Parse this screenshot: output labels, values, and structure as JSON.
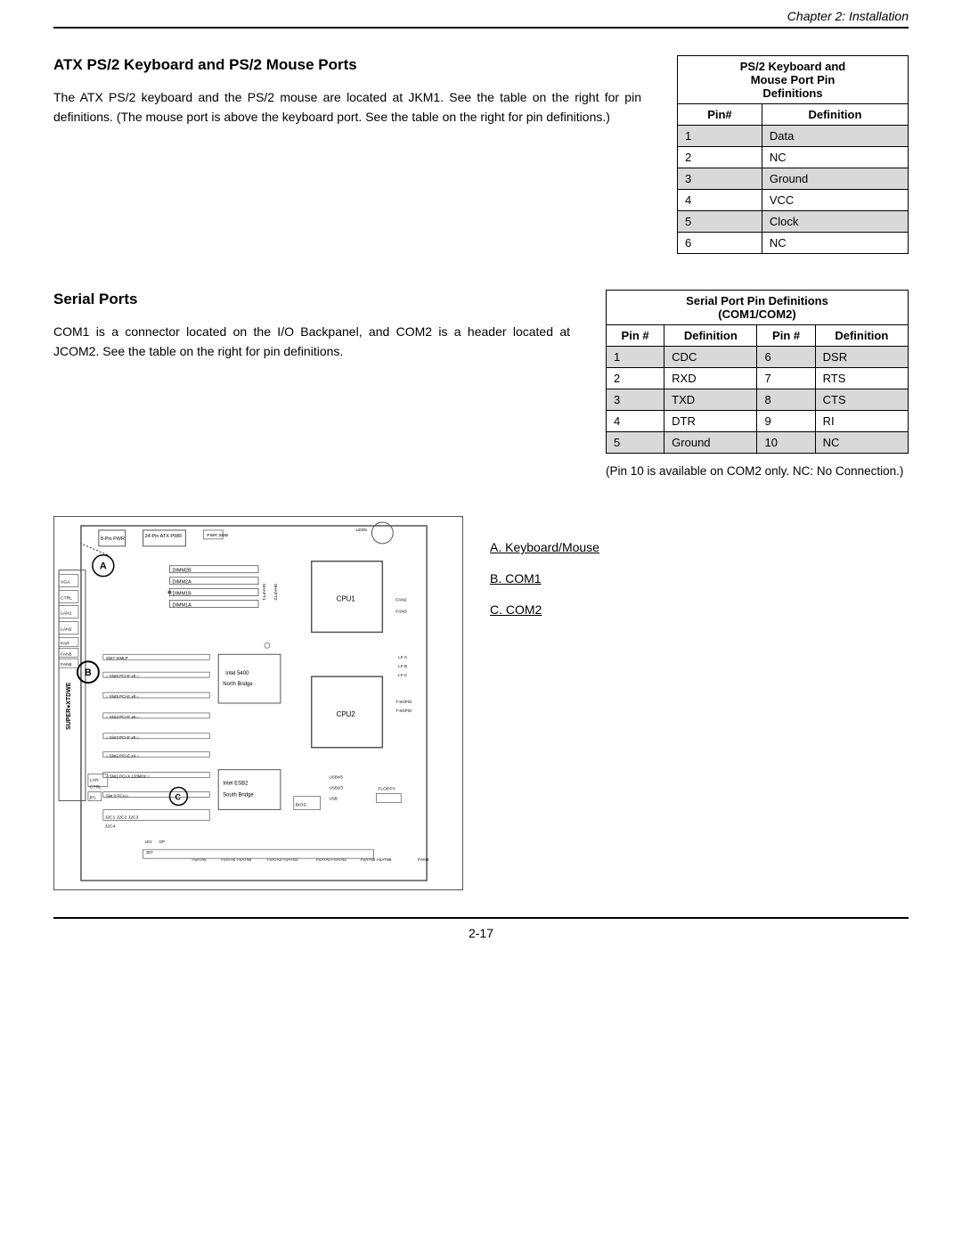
{
  "header": {
    "chapter": "Chapter 2: Installation"
  },
  "ps2_section": {
    "title": "ATX PS/2 Keyboard and PS/2 Mouse Ports",
    "body": "The ATX PS/2 keyboard and the PS/2 mouse are located at JKM1. See the table on the right for pin definitions. (The mouse port is above the keyboard port. See the table on the right for pin definitions.)",
    "table": {
      "title_line1": "PS/2 Keyboard and",
      "title_line2": "Mouse Port Pin",
      "title_line3": "Definitions",
      "col1": "Pin#",
      "col2": "Definition",
      "rows": [
        {
          "pin": "1",
          "def": "Data",
          "shaded": true
        },
        {
          "pin": "2",
          "def": "NC",
          "shaded": false
        },
        {
          "pin": "3",
          "def": "Ground",
          "shaded": true
        },
        {
          "pin": "4",
          "def": "VCC",
          "shaded": false
        },
        {
          "pin": "5",
          "def": "Clock",
          "shaded": true
        },
        {
          "pin": "6",
          "def": "NC",
          "shaded": false
        }
      ]
    }
  },
  "serial_section": {
    "title": "Serial Ports",
    "body": "COM1 is a connector located on the I/O Backpanel, and COM2 is a header located at JCOM2. See the table on the right for pin definitions.",
    "table": {
      "title_line1": "Serial Port Pin Definitions",
      "title_line2": "(COM1/COM2)",
      "col1": "Pin #",
      "col2": "Definition",
      "col3": "Pin #",
      "col4": "Definition",
      "rows": [
        {
          "pin1": "1",
          "def1": "CDC",
          "pin2": "6",
          "def2": "DSR",
          "shaded": true
        },
        {
          "pin1": "2",
          "def1": "RXD",
          "pin2": "7",
          "def2": "RTS",
          "shaded": false
        },
        {
          "pin1": "3",
          "def1": "TXD",
          "pin2": "8",
          "def2": "CTS",
          "shaded": true
        },
        {
          "pin1": "4",
          "def1": "DTR",
          "pin2": "9",
          "def2": "RI",
          "shaded": false
        },
        {
          "pin1": "5",
          "def1": "Ground",
          "pin2": "10",
          "def2": "NC",
          "shaded": true
        }
      ]
    },
    "note": "(Pin 10 is available on COM2 only. NC: No Connection.)"
  },
  "diagram_section": {
    "labels": [
      {
        "letter": "A.",
        "text": "Keyboard/Mouse"
      },
      {
        "letter": "B.",
        "text": "COM1"
      },
      {
        "letter": "C.",
        "text": "COM2"
      }
    ]
  },
  "page_number": "2-17"
}
